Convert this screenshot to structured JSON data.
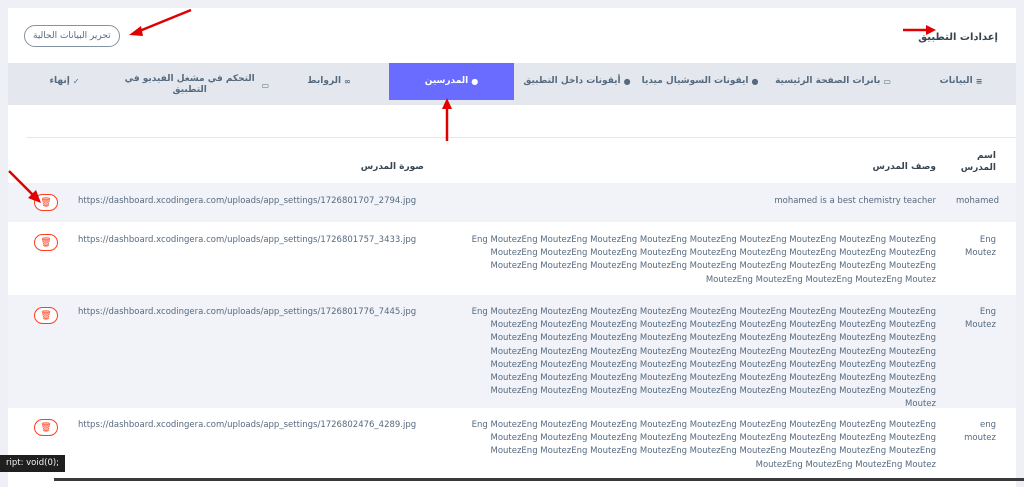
{
  "header": {
    "page_title": "إعدادات التطبيق",
    "edit_button_label": "تحرير البيانات الحالية"
  },
  "tabs": [
    {
      "label": "البيانات",
      "icon": "database-icon",
      "glyph": "≡",
      "active": false
    },
    {
      "label": "بانرات الصفحة الرئيسية",
      "icon": "banner-icon",
      "glyph": "▭",
      "active": false
    },
    {
      "label": "ايقونات السوشيال ميديا",
      "icon": "info-icon",
      "glyph": "●",
      "active": false
    },
    {
      "label": "أيقونات داخل التطبيق",
      "icon": "info-icon",
      "glyph": "●",
      "active": false
    },
    {
      "label": "المدرسين",
      "icon": "user-icon",
      "glyph": "●",
      "active": true
    },
    {
      "label": "الروابط",
      "icon": "link-icon",
      "glyph": "∞",
      "active": false
    },
    {
      "label": "التحكم في مشغل الفيديو في التطبيق",
      "icon": "video-icon",
      "glyph": "▭",
      "active": false
    },
    {
      "label": "إنهاء",
      "icon": "check-circle-icon",
      "glyph": "✓",
      "active": false
    }
  ],
  "table": {
    "headers": {
      "name": "اسم المدرس",
      "description": "وصف المدرس",
      "image": "صورة المدرس"
    },
    "rows": [
      {
        "name": "mohamed",
        "description": "mohamed is a best chemistry teacher",
        "image": "https://dashboard.xcodingera.com/uploads/app_settings/1726801707_2794.jpg"
      },
      {
        "name": "Eng Moutez",
        "description": "Eng MoutezEng MoutezEng MoutezEng MoutezEng MoutezEng MoutezEng MoutezEng MoutezEng MoutezEng MoutezEng MoutezEng MoutezEng MoutezEng MoutezEng MoutezEng MoutezEng MoutezEng MoutezEng MoutezEng MoutezEng MoutezEng MoutezEng MoutezEng MoutezEng MoutezEng MoutezEng MoutezEng MoutezEng MoutezEng MoutezEng MoutezEng Moutez",
        "image": "https://dashboard.xcodingera.com/uploads/app_settings/1726801757_3433.jpg"
      },
      {
        "name": "Eng Moutez",
        "description": "Eng MoutezEng MoutezEng MoutezEng MoutezEng MoutezEng MoutezEng MoutezEng MoutezEng MoutezEng MoutezEng MoutezEng MoutezEng MoutezEng MoutezEng MoutezEng MoutezEng MoutezEng MoutezEng MoutezEng MoutezEng MoutezEng MoutezEng MoutezEng MoutezEng MoutezEng MoutezEng MoutezEng MoutezEng MoutezEng MoutezEng MoutezEng MoutezEng MoutezEng MoutezEng MoutezEng MoutezEng MoutezEng MoutezEng MoutezEng MoutezEng MoutezEng MoutezEng MoutezEng MoutezEng MoutezEng MoutezEng MoutezEng MoutezEng MoutezEng MoutezEng MoutezEng MoutezEng MoutezEng MoutezEng MoutezEng MoutezEng MoutezEng MoutezEng MoutezEng MoutezEng MoutezEng MoutezEng MoutezEng Moutez",
        "image": "https://dashboard.xcodingera.com/uploads/app_settings/1726801776_7445.jpg"
      },
      {
        "name": "eng moutez",
        "description": "Eng MoutezEng MoutezEng MoutezEng MoutezEng MoutezEng MoutezEng MoutezEng MoutezEng MoutezEng MoutezEng MoutezEng MoutezEng MoutezEng MoutezEng MoutezEng MoutezEng MoutezEng MoutezEng MoutezEng MoutezEng MoutezEng MoutezEng MoutezEng MoutezEng MoutezEng MoutezEng MoutezEng MoutezEng MoutezEng MoutezEng Moutez",
        "image": "https://dashboard.xcodingera.com/uploads/app_settings/1726802476_4289.jpg"
      }
    ],
    "delete_icon": "trash-icon"
  },
  "status_bar": {
    "link_preview": "ript: void(0);"
  },
  "colors": {
    "accent": "#696cff",
    "danger": "#ff3e1d",
    "annotation_arrow": "#e00000"
  }
}
